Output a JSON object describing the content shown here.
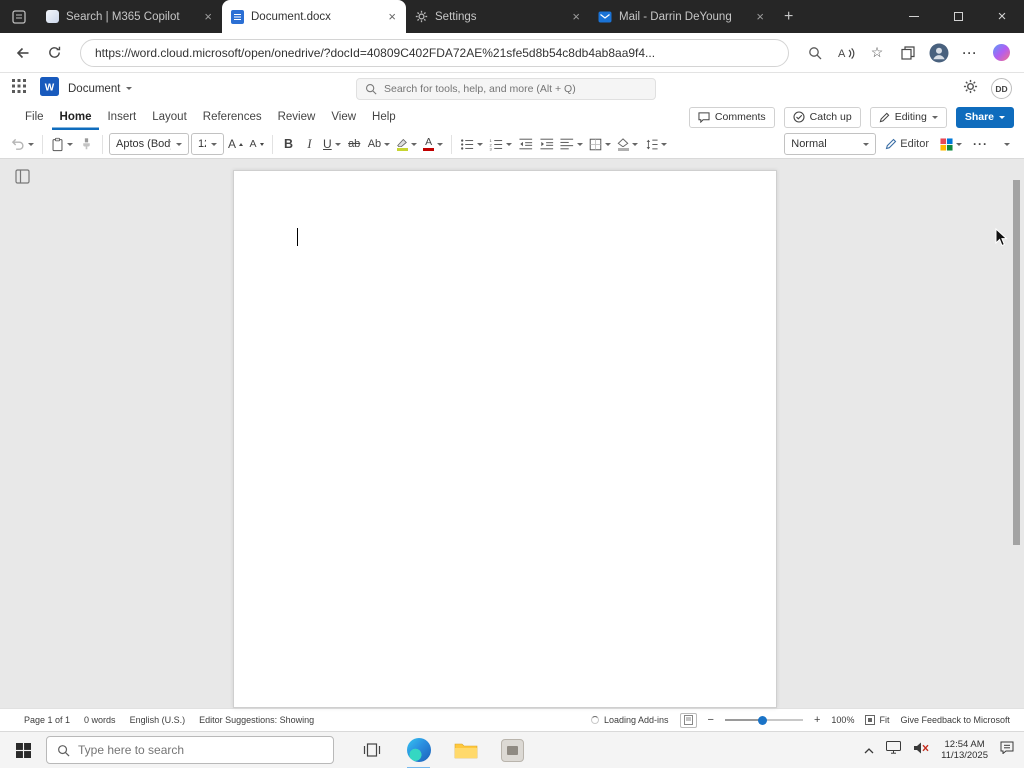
{
  "browser": {
    "tabs": [
      {
        "title": "Search | M365 Copilot"
      },
      {
        "title": "Document.docx"
      },
      {
        "title": "Settings"
      },
      {
        "title": "Mail - Darrin DeYoung"
      }
    ],
    "url": "https://word.cloud.microsoft/open/onedrive/?docId=40809C402FDA72AE%21sfe5d8b54c8db4ab8aa9f4...",
    "accent": "#0f6cbd"
  },
  "app": {
    "title": "Document",
    "search_placeholder": "Search for tools, help, and more (Alt + Q)",
    "avatar_initials": "DD"
  },
  "menu": {
    "items": [
      "File",
      "Home",
      "Insert",
      "Layout",
      "References",
      "Review",
      "View",
      "Help"
    ],
    "active": "Home"
  },
  "collab": {
    "comments": "Comments",
    "catch_up": "Catch up",
    "editing": "Editing",
    "share": "Share"
  },
  "ribbon": {
    "font_name": "Aptos (Body)",
    "font_size": "12",
    "style": "Normal",
    "editor": "Editor",
    "bold": "B",
    "italic": "I",
    "underline": "U",
    "strikethrough": "ab",
    "change_case": "Ab",
    "grow_font": "A",
    "shrink_font": "A",
    "font_color": "A"
  },
  "status": {
    "page": "Page 1 of 1",
    "words": "0 words",
    "language": "English (U.S.)",
    "suggestions": "Editor Suggestions: Showing",
    "loading_addins": "Loading Add-ins",
    "zoom": "100%",
    "fit": "Fit",
    "feedback": "Give Feedback to Microsoft"
  },
  "taskbar": {
    "search_placeholder": "Type here to search",
    "time": "12:54 AM",
    "date": "11/13/2025"
  }
}
